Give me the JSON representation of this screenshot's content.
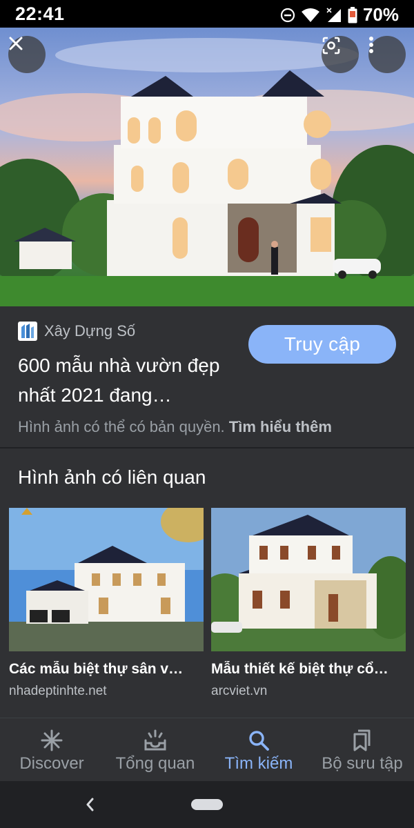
{
  "status_bar": {
    "time": "22:41",
    "battery": "70%"
  },
  "hero": {
    "close_icon": "close-icon",
    "lens_icon": "lens-icon",
    "more_icon": "more-vert-icon"
  },
  "result": {
    "source": "Xây Dựng Số",
    "visit_label": "Truy cập",
    "title": "600 mẫu nhà vườn đẹp nhất 2021 đang…",
    "copyright_text": "Hình ảnh có thể có bản quyền. ",
    "learn_more": "Tìm hiểu thêm"
  },
  "related": {
    "heading": "Hình ảnh có liên quan",
    "items": [
      {
        "title": "Các mẫu biệt thự sân v…",
        "site": "nhadeptinhte.net"
      },
      {
        "title": "Mẫu thiết kế biệt thự cổ…",
        "site": "arcviet.vn"
      }
    ]
  },
  "bottom_nav": [
    {
      "label": "Discover",
      "icon": "asterisk-icon",
      "active": false
    },
    {
      "label": "Tổng quan",
      "icon": "inbox-icon",
      "active": false
    },
    {
      "label": "Tìm kiếm",
      "icon": "search-icon",
      "active": true
    },
    {
      "label": "Bộ sưu tập",
      "icon": "collections-icon",
      "active": false
    }
  ],
  "colors": {
    "accent": "#8ab4f8",
    "surface": "#303134",
    "background": "#202124"
  }
}
